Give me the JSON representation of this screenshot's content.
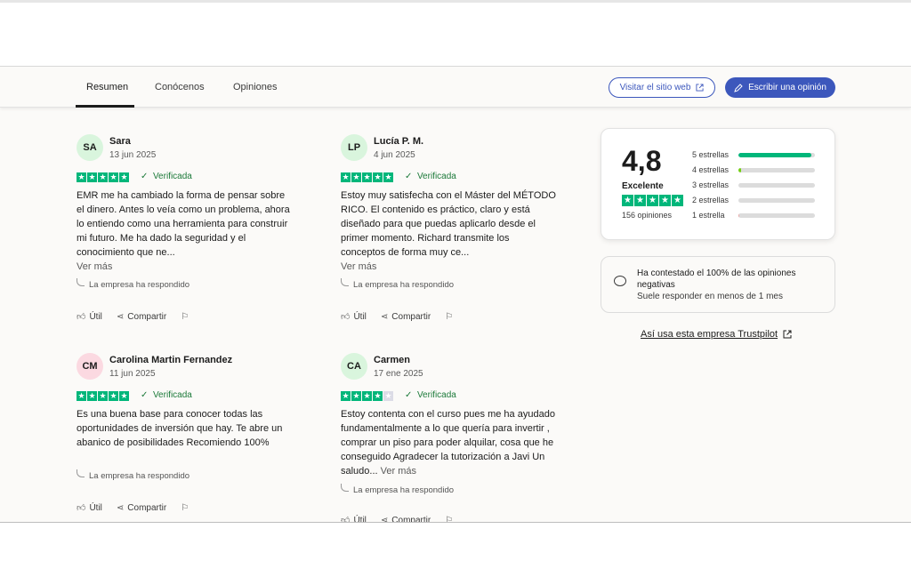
{
  "nav": {
    "tabs": [
      {
        "label": "Resumen",
        "active": true
      },
      {
        "label": "Conócenos",
        "active": false
      },
      {
        "label": "Opiniones",
        "active": false
      }
    ],
    "visit_label": "Visitar el sitio web",
    "write_label": "Escribir una opinión"
  },
  "colors": {
    "brand_blue": "#3c57bc",
    "star_green": "#00b67a",
    "star_empty": "#dcdce6"
  },
  "reviews": [
    {
      "initials": "SA",
      "avatar_color": "#d9f5dd",
      "name": "Sara",
      "date": "13 jun 2025",
      "stars": 5,
      "verified": "Verificada",
      "text": "EMR me ha cambiado la forma de pensar sobre el dinero. Antes lo veía como un problema, ahora lo entiendo como una herramienta para construir mi futuro. Me ha dado la seguridad y el conocimiento que ne...",
      "more": "Ver más",
      "responded": "La empresa ha respondido",
      "useful": "Útil",
      "share": "Compartir"
    },
    {
      "initials": "LP",
      "avatar_color": "#d9f5dd",
      "name": "Lucía P. M.",
      "date": "4 jun 2025",
      "stars": 5,
      "verified": "Verificada",
      "text": "Estoy muy satisfecha con el Máster del MÉTODO RICO. El contenido es práctico, claro y está diseñado para que puedas aplicarlo desde el primer momento. Richard transmite los conceptos de forma muy ce...",
      "more": "Ver más",
      "responded": "La empresa ha respondido",
      "useful": "Útil",
      "share": "Compartir"
    },
    {
      "initials": "CM",
      "avatar_color": "#fbd9e1",
      "name": "Carolina Martin Fernandez",
      "date": "11 jun 2025",
      "stars": 5,
      "verified": "Verificada",
      "text": "Es una buena base para conocer todas las oportunidades de inversión que hay. Te abre un abanico de posibilidades Recomiendo 100%",
      "more": "",
      "responded": "La empresa ha respondido",
      "useful": "Útil",
      "share": "Compartir"
    },
    {
      "initials": "CA",
      "avatar_color": "#d9f5dd",
      "name": "Carmen",
      "date": "17 ene 2025",
      "stars": 4,
      "verified": "Verificada",
      "text": "Estoy contenta con el curso pues me ha ayudado fundamentalmente a lo que quería para invertir , comprar un piso para poder alquilar, cosa que he conseguido Agradecer la tutorización a Javi Un saludo...",
      "more": "Ver más",
      "responded": "La empresa ha respondido",
      "useful": "Útil",
      "share": "Compartir"
    }
  ],
  "rating": {
    "score": "4,8",
    "label": "Excelente",
    "count": "156 opiniones",
    "distribution": [
      {
        "label": "5 estrellas",
        "fraction": 0.95,
        "color": "#00b67a"
      },
      {
        "label": "4 estrellas",
        "fraction": 0.04,
        "color": "#73cf11"
      },
      {
        "label": "3 estrellas",
        "fraction": 0.0,
        "color": "#ffce00"
      },
      {
        "label": "2 estrellas",
        "fraction": 0.0,
        "color": "#ff8622"
      },
      {
        "label": "1 estrella",
        "fraction": 0.01,
        "color": "#e8a8a8"
      }
    ]
  },
  "reply_card": {
    "title": "Ha contestado el 100% de las opiniones negativas",
    "subtitle": "Suele responder en menos de 1 mes"
  },
  "trustpilot_link": "Así usa esta empresa Trustpilot"
}
